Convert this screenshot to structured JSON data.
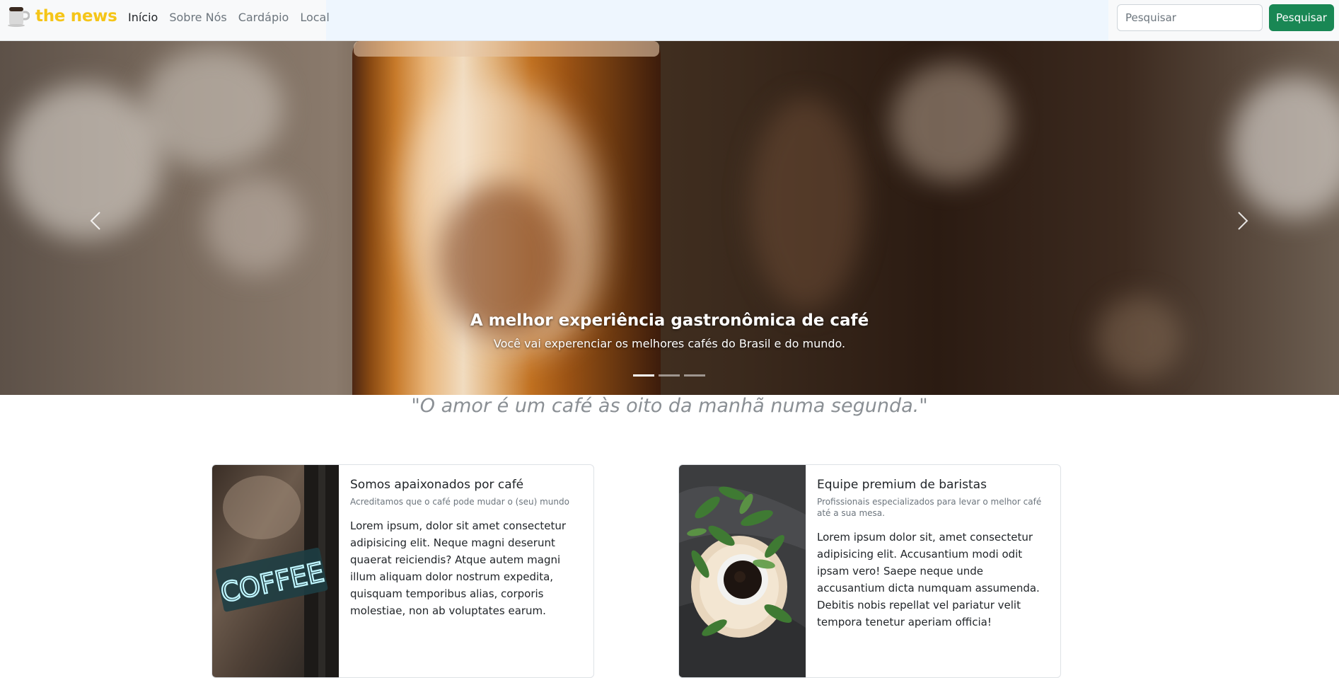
{
  "navbar": {
    "brand": "the news",
    "links": [
      "Início",
      "Sobre Nós",
      "Cardápio",
      "Local"
    ],
    "search_placeholder": "Pesquisar",
    "search_button": "Pesquisar"
  },
  "carousel": {
    "caption_title": "A melhor experiência gastronômica de café",
    "caption_text": "Você vai experenciar os melhores cafés do Brasil e do mundo.",
    "slide_count": 3,
    "active_slide": 1
  },
  "quote": "\"O amor é um café às oito da manhã numa segunda.\"",
  "cards": [
    {
      "title": "Somos apaixonados por café",
      "subtitle": "Acreditamos que o café pode mudar o (seu) mundo",
      "text": "Lorem ipsum, dolor sit amet consectetur adipisicing elit. Neque magni deserunt quaerat reiciendis? Atque autem magni illum aliquam dolor nostrum expedita, quisquam temporibus alias, corporis molestiae, non ab voluptates earum.",
      "image_sign": "COFFEE"
    },
    {
      "title": "Equipe premium de baristas",
      "subtitle": "Profissionais especializados para levar o melhor café até a sua mesa.",
      "text": "Lorem ipsum dolor sit, amet consectetur adipisicing elit. Accusantium modi odit ipsam vero! Saepe neque unde accusantium dicta numquam assumenda. Debitis nobis repellat vel pariatur velit tempora tenetur aperiam officia!"
    }
  ],
  "colors": {
    "brand": "#f5c518",
    "search_button": "#198754"
  }
}
